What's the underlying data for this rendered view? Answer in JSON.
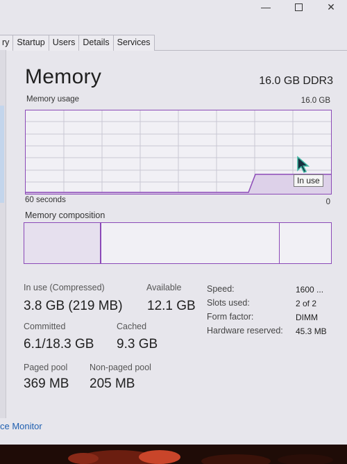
{
  "tabs": [
    "ry",
    "Startup",
    "Users",
    "Details",
    "Services"
  ],
  "memory": {
    "title": "Memory",
    "spec": "16.0 GB DDR3",
    "usage_label": "Memory usage",
    "usage_max": "16.0 GB",
    "time_left": "60 seconds",
    "time_right": "0",
    "tooltip": "In use",
    "composition_label": "Memory composition"
  },
  "stats": {
    "in_use_label": "In use (Compressed)",
    "in_use_value": "3.8 GB (219 MB)",
    "available_label": "Available",
    "available_value": "12.1 GB",
    "committed_label": "Committed",
    "committed_value": "6.1/18.3 GB",
    "cached_label": "Cached",
    "cached_value": "9.3 GB",
    "paged_label": "Paged pool",
    "paged_value": "369 MB",
    "nonpaged_label": "Non-paged pool",
    "nonpaged_value": "205 MB"
  },
  "details": {
    "speed_label": "Speed:",
    "speed_value": "1600 ...",
    "slots_label": "Slots used:",
    "slots_value": "2 of 2",
    "form_label": "Form factor:",
    "form_value": "DIMM",
    "reserved_label": "Hardware reserved:",
    "reserved_value": "45.3 MB"
  },
  "footer": {
    "link": "ce Monitor"
  },
  "colors": {
    "accent": "#8b49b7",
    "graph_bg": "#f1f0f5",
    "window_bg": "#e7e6ec"
  }
}
